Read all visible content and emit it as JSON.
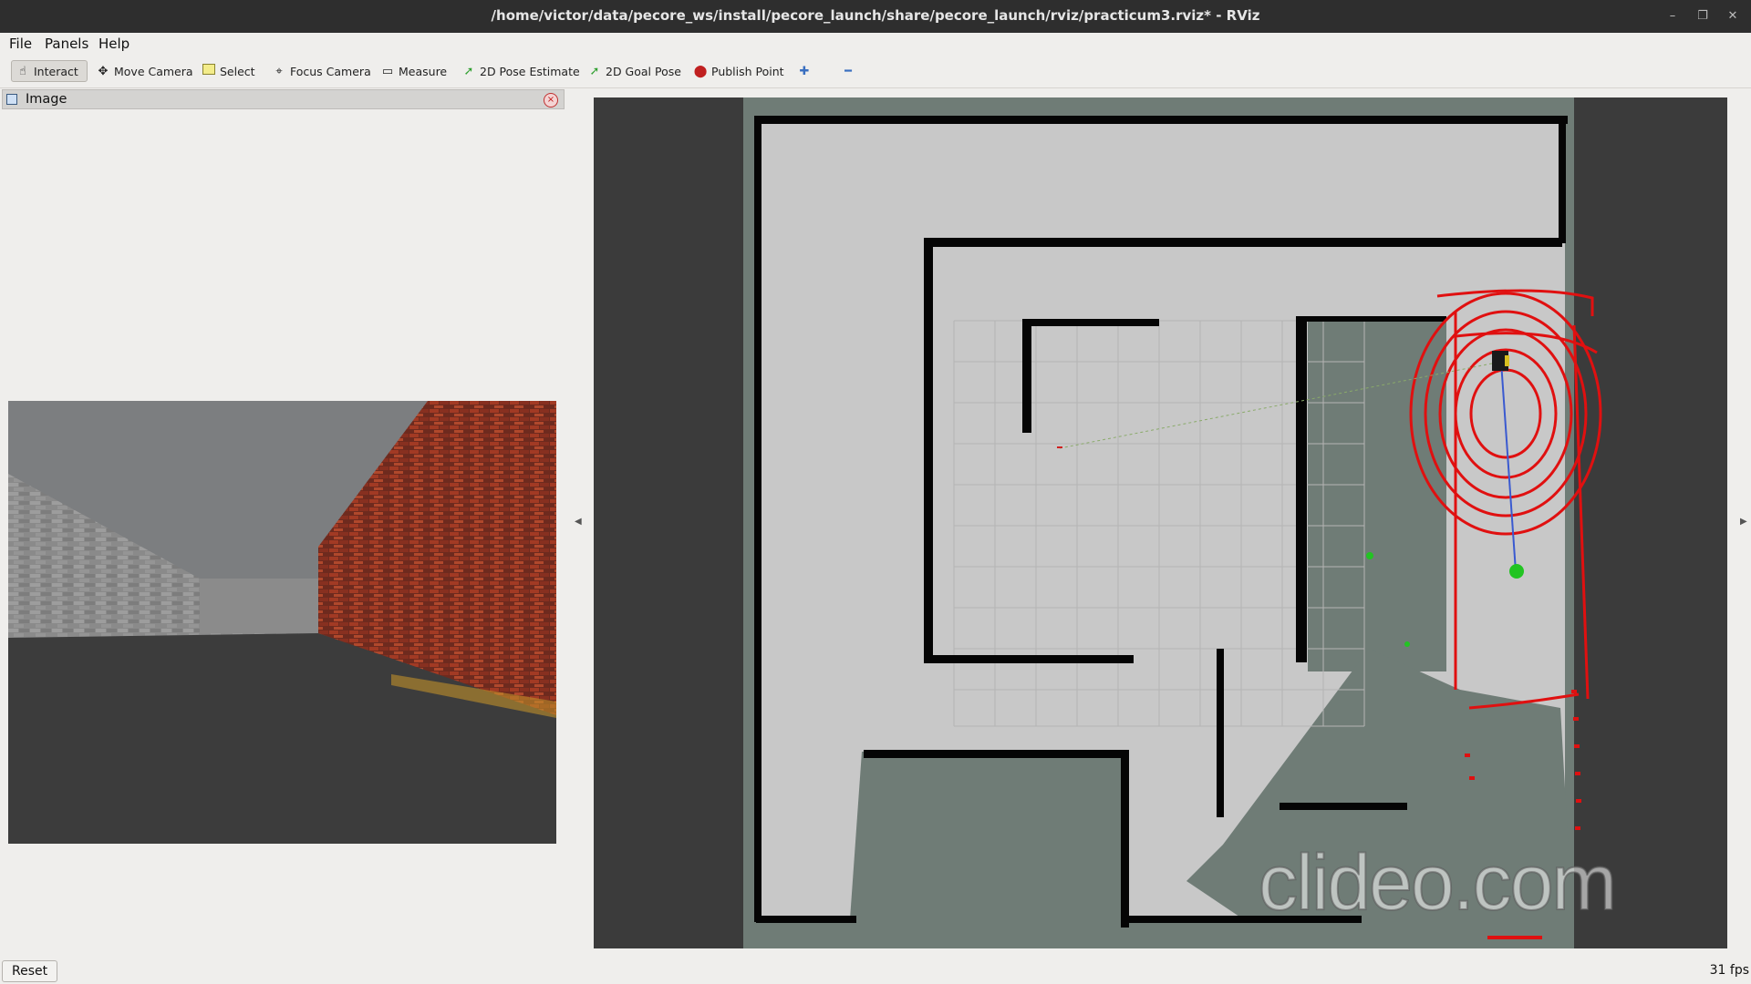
{
  "window": {
    "title": "/home/victor/data/pecore_ws/install/pecore_launch/share/pecore_launch/rviz/practicum3.rviz* - RViz",
    "minimize_glyph": "–",
    "restore_glyph": "❐",
    "close_glyph": "✕"
  },
  "menu": {
    "file": "File",
    "panels": "Panels",
    "help": "Help"
  },
  "toolbar": {
    "interact": "Interact",
    "move_camera": "Move Camera",
    "select": "Select",
    "focus_camera": "Focus Camera",
    "measure": "Measure",
    "pose_estimate": "2D Pose Estimate",
    "goal_pose": "2D Goal Pose",
    "publish_point": "Publish Point",
    "add_glyph": "✚",
    "remove_glyph": "━"
  },
  "image_panel": {
    "title": "Image",
    "close_glyph": "×"
  },
  "viewport": {
    "watermark": "clideo.com"
  },
  "status": {
    "reset_label": "Reset",
    "fps": "31 fps"
  },
  "colors": {
    "laser": "#e01010",
    "map_free": "#c8c8c8",
    "map_unknown": "#6f7c76",
    "map_wall": "#050505",
    "goal": "#22c422"
  }
}
